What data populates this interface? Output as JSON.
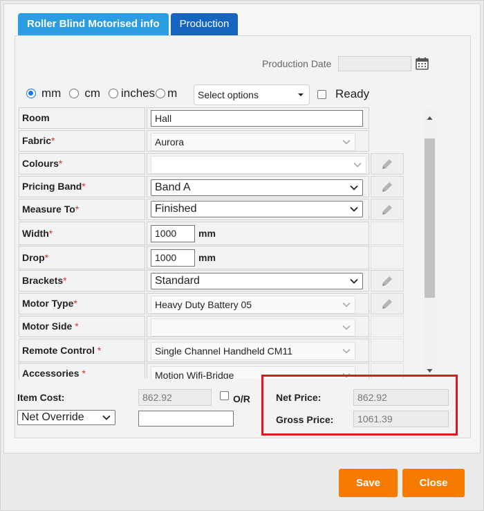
{
  "tabs": [
    {
      "label": "Roller Blind Motorised info",
      "active": true
    },
    {
      "label": "Production",
      "active": false
    }
  ],
  "production_date": {
    "label": "Production Date",
    "value": ""
  },
  "units": {
    "options": [
      "mm",
      "cm",
      "inches",
      "m"
    ],
    "selected": "mm",
    "select_placeholder": "Select options",
    "ready_label": "Ready"
  },
  "rows": [
    {
      "label": "Room",
      "required": false,
      "value": "Hall"
    },
    {
      "label": "Fabric",
      "required": true,
      "value": "Aurora"
    },
    {
      "label": "Colours",
      "required": true,
      "value": ""
    },
    {
      "label": "Pricing Band",
      "required": true,
      "value": "Band A"
    },
    {
      "label": "Measure To",
      "required": true,
      "value": "Finished"
    },
    {
      "label": "Width",
      "required": true,
      "value": "1000",
      "unit": "mm"
    },
    {
      "label": "Drop",
      "required": true,
      "value": "1000",
      "unit": "mm"
    },
    {
      "label": "Brackets",
      "required": true,
      "value": "Standard"
    },
    {
      "label": "Motor Type",
      "required": true,
      "value": "Heavy Duty Battery 05"
    },
    {
      "label": "Motor Side",
      "required": true,
      "required_mark": " *",
      "value": ""
    },
    {
      "label": "Remote Control",
      "required": true,
      "required_mark": " *",
      "value": "Single Channel Handheld CM11"
    },
    {
      "label": "Accessories",
      "required": true,
      "required_mark": " *",
      "value": "Motion Wifi-Bridge"
    }
  ],
  "footer": {
    "item_cost_label": "Item Cost:",
    "item_cost_value": "862.92",
    "or_label": "O/R",
    "override_select": "Net Override",
    "override_value": "",
    "net_price_label": "Net Price:",
    "net_price_value": "862.92",
    "gross_price_label": "Gross Price:",
    "gross_price_value": "1061.39"
  },
  "buttons": {
    "save": "Save",
    "close": "Close"
  },
  "colors": {
    "accent_orange": "#f57c00",
    "tab_light": "#2b9de3",
    "tab_dark": "#1565c0",
    "highlight_red": "#e3171a"
  }
}
